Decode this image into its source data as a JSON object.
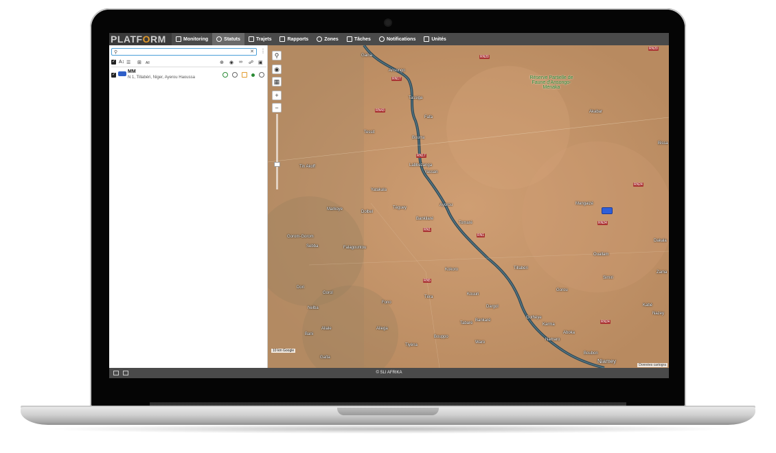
{
  "app": {
    "logo_prefix": "PLATF",
    "logo_o": "O",
    "logo_suffix": "RM"
  },
  "nav": [
    {
      "label": "Monitoring",
      "icon": "bar-chart-icon",
      "active": false
    },
    {
      "label": "Statuts",
      "icon": "globe-icon",
      "active": true
    },
    {
      "label": "Trajets",
      "icon": "flag-icon",
      "active": false
    },
    {
      "label": "Rapports",
      "icon": "report-icon",
      "active": false
    },
    {
      "label": "Zones",
      "icon": "zones-icon",
      "active": false
    },
    {
      "label": "Tâches",
      "icon": "tasks-icon",
      "active": false
    },
    {
      "label": "Notifications",
      "icon": "alarm-icon",
      "active": false
    },
    {
      "label": "Unités",
      "icon": "truck-icon",
      "active": false
    }
  ],
  "panel": {
    "search_value": "",
    "toolbar_all_label": "All",
    "units": [
      {
        "name": "MM",
        "address": "N 1, Tillabéri, Niger, Ayerou Haoussa"
      }
    ]
  },
  "map": {
    "labels": [
      {
        "text": "Gaina",
        "cls": ""
      },
      {
        "text": "Ansongo",
        "cls": ""
      },
      {
        "text": "Tassiga",
        "cls": ""
      },
      {
        "text": "Réserve Partielle de Faune d'Ansongo-Ménaka",
        "cls": "green"
      },
      {
        "text": "Akabar",
        "cls": ""
      },
      {
        "text": "Fafa",
        "cls": ""
      },
      {
        "text": "Tessit",
        "cls": ""
      },
      {
        "text": "Bourra",
        "cls": ""
      },
      {
        "text": "Labbezanga",
        "cls": ""
      },
      {
        "text": "Yassan",
        "cls": ""
      },
      {
        "text": "Tin Akoff",
        "cls": ""
      },
      {
        "text": "Yatakala",
        "cls": ""
      },
      {
        "text": "Markoye",
        "cls": ""
      },
      {
        "text": "Dolbel",
        "cls": ""
      },
      {
        "text": "Téguey",
        "cls": ""
      },
      {
        "text": "Ayorou",
        "cls": ""
      },
      {
        "text": "Bankilaré",
        "cls": ""
      },
      {
        "text": "Tomaré",
        "cls": ""
      },
      {
        "text": "Mangaizé",
        "cls": ""
      },
      {
        "text": "Gorom-Gorom",
        "cls": ""
      },
      {
        "text": "Sebba",
        "cls": ""
      },
      {
        "text": "Falagountou",
        "cls": ""
      },
      {
        "text": "Dakala",
        "cls": ""
      },
      {
        "text": "Ouallam",
        "cls": ""
      },
      {
        "text": "Kokoro",
        "cls": ""
      },
      {
        "text": "Tillabéri",
        "cls": ""
      },
      {
        "text": "Simiri",
        "cls": ""
      },
      {
        "text": "Zama",
        "cls": ""
      },
      {
        "text": "Dori",
        "cls": ""
      },
      {
        "text": "Gorol",
        "cls": ""
      },
      {
        "text": "Kouuri",
        "cls": ""
      },
      {
        "text": "Gorou",
        "cls": ""
      },
      {
        "text": "Fono",
        "cls": ""
      },
      {
        "text": "Téra",
        "cls": ""
      },
      {
        "text": "Dargol",
        "cls": ""
      },
      {
        "text": "Kabé",
        "cls": ""
      },
      {
        "text": "Nelba",
        "cls": ""
      },
      {
        "text": "Gothèye",
        "cls": ""
      },
      {
        "text": "Karma",
        "cls": ""
      },
      {
        "text": "Nazey",
        "cls": ""
      },
      {
        "text": "Tabaré",
        "cls": ""
      },
      {
        "text": "Bankaré",
        "cls": ""
      },
      {
        "text": "Aliale",
        "cls": ""
      },
      {
        "text": "Aliega",
        "cls": ""
      },
      {
        "text": "Bani",
        "cls": ""
      },
      {
        "text": "Bouppo",
        "cls": ""
      },
      {
        "text": "Namaro",
        "cls": ""
      },
      {
        "text": "Aboka",
        "cls": ""
      },
      {
        "text": "Waro",
        "cls": ""
      },
      {
        "text": "Tiyéna",
        "cls": ""
      },
      {
        "text": "Gaïta",
        "cls": ""
      },
      {
        "text": "Boubon",
        "cls": ""
      },
      {
        "text": "Niamey",
        "cls": "big"
      },
      {
        "text": "Bissa",
        "cls": ""
      }
    ],
    "roads": [
      "RN20",
      "RN20",
      "RN17",
      "RN43",
      "RN17",
      "RN24",
      "RN24",
      "RN1",
      "RN1",
      "RN5",
      "RN24"
    ],
    "attribution": "Données cartogra",
    "scale_label": "10 km",
    "google_label": "Google"
  },
  "footer": {
    "copyright": "© SLI AFRIKA"
  },
  "colors": {
    "topbar": "#4a4a4a",
    "accent_logo": "#e39b2c",
    "river": "#2f4a5a",
    "map_ground": "#c4946a",
    "marker": "#2f5fd8",
    "search_border": "#4a9fd8"
  }
}
